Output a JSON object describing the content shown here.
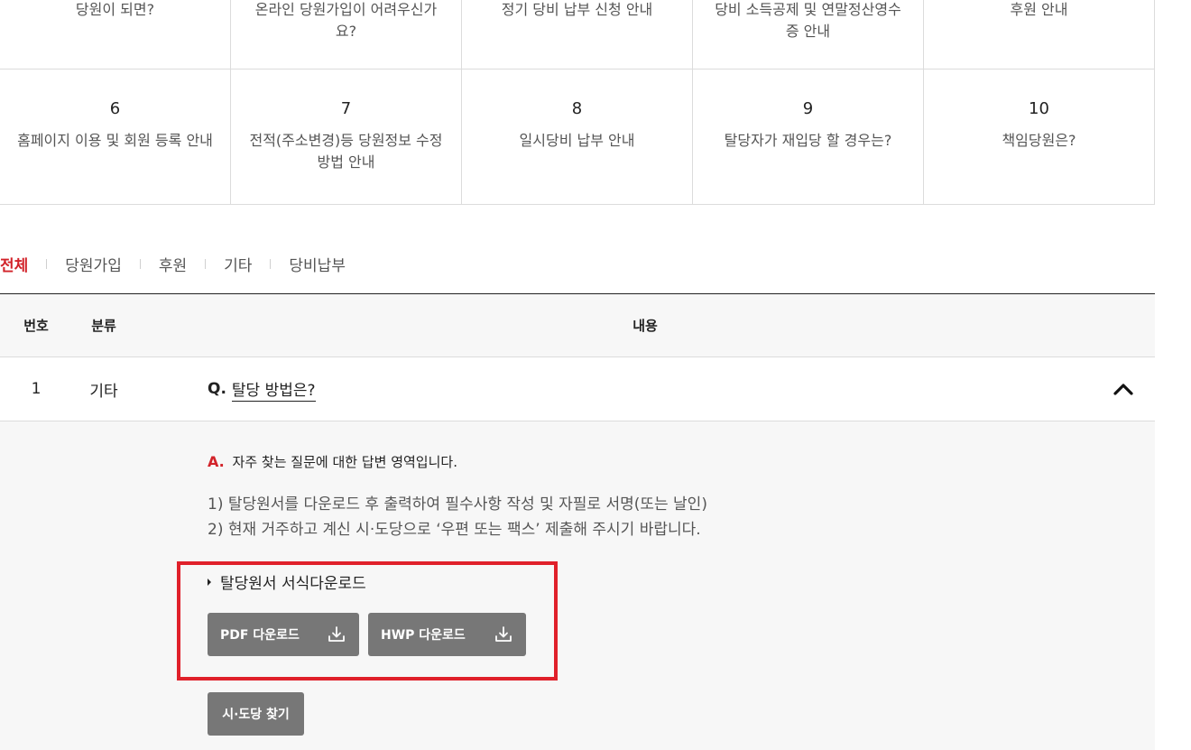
{
  "topics_row1": [
    {
      "title": "당원이 되면?"
    },
    {
      "title": "온라인 당원가입이 어려우신가요?"
    },
    {
      "title": "정기 당비 납부 신청 안내"
    },
    {
      "title": "당비 소득공제 및 연말정산영수증 안내"
    },
    {
      "title": "후원 안내"
    }
  ],
  "topics_row2": [
    {
      "num": "6",
      "title": "홈페이지 이용 및 회원 등록 안내"
    },
    {
      "num": "7",
      "title": "전적(주소변경)등 당원정보 수정 방법 안내"
    },
    {
      "num": "8",
      "title": "일시당비 납부 안내"
    },
    {
      "num": "9",
      "title": "탈당자가 재입당 할 경우는?"
    },
    {
      "num": "10",
      "title": "책임당원은?"
    }
  ],
  "tabs": [
    "전체",
    "당원가입",
    "후원",
    "기타",
    "당비납부"
  ],
  "active_tab": "전체",
  "table": {
    "headers": {
      "num": "번호",
      "category": "분류",
      "content": "내용"
    },
    "rows": [
      {
        "num": "1",
        "category": "기타",
        "q_mark": "Q.",
        "question": "탈당 방법은?"
      }
    ]
  },
  "answer": {
    "a_mark": "A.",
    "heading": "자주 찾는 질문에 대한 답변 영역입니다.",
    "lines": [
      "1) 탈당원서를 다운로드 후 출력하여 필수사항 작성 및 자필로 서명(또는 날인)",
      "2) 현재 거주하고 계신 시·도당으로 ‘우편 또는 팩스’ 제출해 주시기 바랍니다."
    ],
    "download_title": "탈당원서 서식다운로드",
    "pdf_label": "PDF 다운로드",
    "hwp_label": "HWP 다운로드",
    "find_label": "시·도당 찾기"
  },
  "colors": {
    "accent": "#d2232a",
    "highlight_border": "#e0202a",
    "button_bg": "#777777",
    "panel_bg": "#f7f7f7"
  },
  "icons": {
    "download": "download-icon",
    "toggle": "chevron-up-icon"
  }
}
